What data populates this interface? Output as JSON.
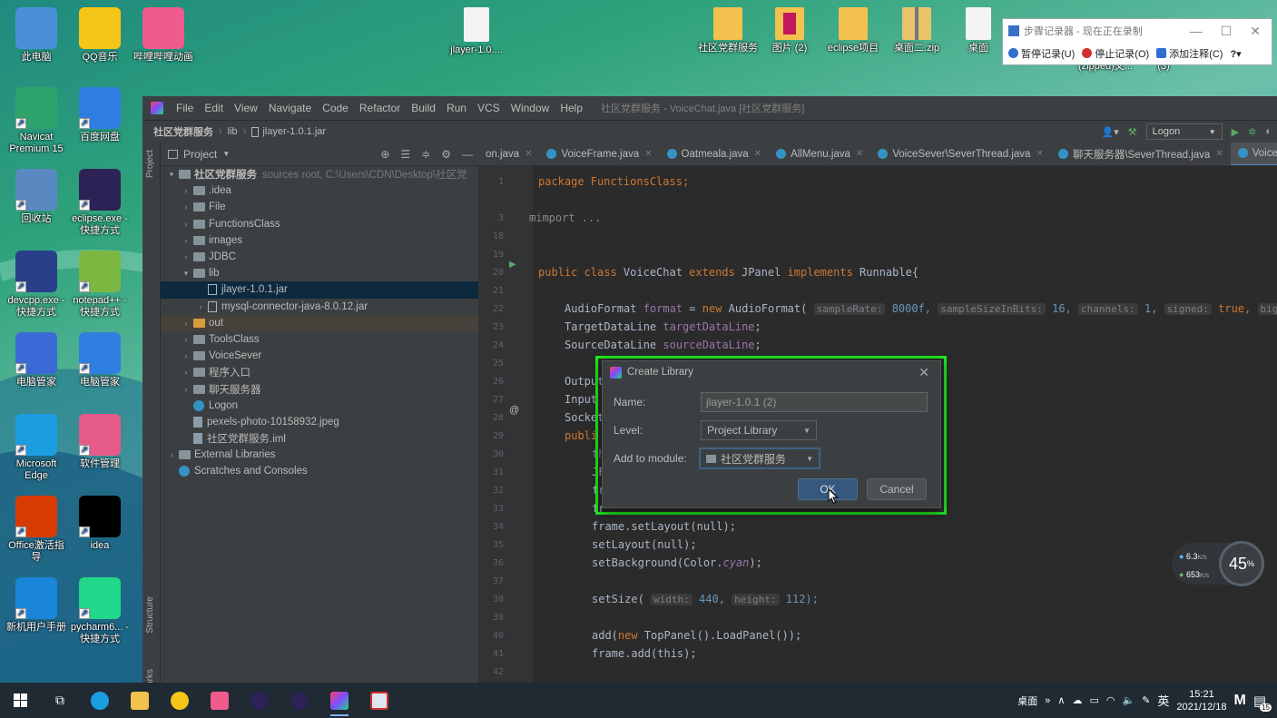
{
  "desktop": {
    "left_icons": [
      {
        "label": "此电脑",
        "icon": "computer-icon",
        "color": "#4a90d9"
      },
      {
        "label": "QQ音乐",
        "icon": "qqmusic-icon",
        "color": "#f5c518"
      },
      {
        "label": "哔哩哔哩动画",
        "icon": "bilibili-icon",
        "color": "#f05a8c"
      },
      {
        "label": "Navicat Premium 15",
        "icon": "navicat-icon",
        "color": "#2ea36b"
      },
      {
        "label": "百度网盘",
        "icon": "baidu-netdisk-icon",
        "color": "#2f7de0"
      },
      {
        "label": "回收站",
        "icon": "recycle-bin-icon",
        "color": "#5a88c0"
      },
      {
        "label": "eclipse.exe - 快捷方式",
        "icon": "eclipse-icon",
        "color": "#2c2255"
      },
      {
        "label": "devcpp.exe - 快捷方式",
        "icon": "devcpp-icon",
        "color": "#2a3f8a"
      },
      {
        "label": "notepad++ - 快捷方式",
        "icon": "notepadpp-icon",
        "color": "#7bb741"
      },
      {
        "label": "电脑管家",
        "icon": "pc-manager-icon",
        "color": "#3b6ad6"
      },
      {
        "label": "电脑管家",
        "icon": "pc-manager-shield-icon",
        "color": "#2f7fe0"
      },
      {
        "label": "Microsoft Edge",
        "icon": "edge-icon",
        "color": "#1b9de2"
      },
      {
        "label": "软件管理",
        "icon": "software-manager-icon",
        "color": "#e65a8a"
      },
      {
        "label": "Office激活指导",
        "icon": "office-icon",
        "color": "#d83b01"
      },
      {
        "label": "idea",
        "icon": "intellij-icon",
        "color": "#000000"
      },
      {
        "label": "新机用户手册",
        "icon": "manual-icon",
        "color": "#1a86d9"
      },
      {
        "label": "pycharm6... - 快捷方式",
        "icon": "pycharm-icon",
        "color": "#21d789"
      }
    ],
    "top_icons": [
      {
        "label": "jlayer-1.0....",
        "icon": "file-icon"
      },
      {
        "label": "社区党群服务",
        "icon": "folder-icon"
      },
      {
        "label": "图片 (2)",
        "icon": "folder-pictures-icon"
      },
      {
        "label": "eclipse项目",
        "icon": "folder-icon"
      },
      {
        "label": "桌面二.zip",
        "icon": "zip-icon"
      },
      {
        "label": "桌面",
        "icon": "folder-icon"
      }
    ],
    "partial_labels": [
      "(zipped)文...",
      "(3)"
    ]
  },
  "psr": {
    "title": "步骤记录器 - 现在正在录制",
    "pause": "暂停记录(U)",
    "stop": "停止记录(O)",
    "comment": "添加注释(C)"
  },
  "ide": {
    "menu": [
      "File",
      "Edit",
      "View",
      "Navigate",
      "Code",
      "Refactor",
      "Build",
      "Run",
      "VCS",
      "Window",
      "Help"
    ],
    "window_title": "社区党群服务 - VoiceChat.java [社区党群服务]",
    "breadcrumb": [
      "社区党群服务",
      "lib",
      "jlayer-1.0.1.jar"
    ],
    "run_config": "Logon",
    "project_header": "Project",
    "side_labels": {
      "project": "Project",
      "structure": "Structure",
      "bookmarks": "arks"
    },
    "tree": [
      {
        "indent": 0,
        "arrow": "▾",
        "icon": "folder",
        "label": "社区党群服务",
        "muted": "sources root,  C:\\Users\\CDN\\Desktop\\社区党"
      },
      {
        "indent": 1,
        "arrow": "›",
        "icon": "folder",
        "label": ".idea"
      },
      {
        "indent": 1,
        "arrow": "›",
        "icon": "folder",
        "label": "File"
      },
      {
        "indent": 1,
        "arrow": "›",
        "icon": "folder",
        "label": "FunctionsClass"
      },
      {
        "indent": 1,
        "arrow": "›",
        "icon": "folder",
        "label": "images"
      },
      {
        "indent": 1,
        "arrow": "›",
        "icon": "folder",
        "label": "JDBC"
      },
      {
        "indent": 1,
        "arrow": "▾",
        "icon": "folder",
        "label": "lib"
      },
      {
        "indent": 2,
        "arrow": "",
        "icon": "jar",
        "label": "jlayer-1.0.1.jar",
        "selected": true
      },
      {
        "indent": 2,
        "arrow": "›",
        "icon": "jar",
        "label": "mysql-connector-java-8.0.12.jar"
      },
      {
        "indent": 1,
        "arrow": "›",
        "icon": "folder-orange",
        "label": "out",
        "out": true
      },
      {
        "indent": 1,
        "arrow": "›",
        "icon": "folder",
        "label": "ToolsClass"
      },
      {
        "indent": 1,
        "arrow": "›",
        "icon": "folder",
        "label": "VoiceSever"
      },
      {
        "indent": 1,
        "arrow": "›",
        "icon": "folder",
        "label": "程序入口"
      },
      {
        "indent": 1,
        "arrow": "›",
        "icon": "folder",
        "label": "聊天服务器"
      },
      {
        "indent": 1,
        "arrow": "",
        "icon": "class",
        "label": "Logon"
      },
      {
        "indent": 1,
        "arrow": "",
        "icon": "image",
        "label": "pexels-photo-10158932.jpeg"
      },
      {
        "indent": 1,
        "arrow": "",
        "icon": "image",
        "label": "社区党群服务.iml"
      },
      {
        "indent": 0,
        "arrow": "›",
        "icon": "lib",
        "label": "External Libraries"
      },
      {
        "indent": 0,
        "arrow": "",
        "icon": "scratch",
        "label": "Scratches and Consoles"
      }
    ],
    "tabs": [
      {
        "label": "on.java",
        "active": false
      },
      {
        "label": "VoiceFrame.java",
        "active": false
      },
      {
        "label": "Oatmeala.java",
        "active": false
      },
      {
        "label": "AllMenu.java",
        "active": false
      },
      {
        "label": "VoiceSever\\SeverThread.java",
        "active": false
      },
      {
        "label": "聊天服务器\\SeverThread.java",
        "active": false
      },
      {
        "label": "Voice",
        "active": true
      }
    ],
    "line_numbers": [
      "1",
      "3",
      "18",
      "19",
      "20",
      "21",
      "22",
      "23",
      "24",
      "25",
      "26",
      "27",
      "28",
      "29",
      "30",
      "31",
      "32",
      "33",
      "34",
      "35",
      "36",
      "37",
      "38",
      "39",
      "40",
      "41",
      "42"
    ],
    "code": {
      "l1": "package FunctionsClass;",
      "l3": "import ...",
      "l20a": "public class ",
      "l20b": "VoiceChat ",
      "l20c": "extends ",
      "l20d": "JPanel ",
      "l20e": "implements ",
      "l20f": "Runnable{",
      "l22a": "AudioFormat ",
      "l22b": "format",
      "l22c": " = ",
      "l22d": "new ",
      "l22e": "AudioFormat(",
      "l22h1": "sampleRate:",
      "l22v1": "8000f,",
      "l22h2": "sampleSizeInBits:",
      "l22v2": "16,",
      "l22h3": "channels:",
      "l22v3": "1,",
      "l22h4": "signed:",
      "l22v4": "true,",
      "l22h5": "bigEndian:",
      "l23a": "TargetDataLine ",
      "l23b": "targetDataLine",
      "l24a": "SourceDataLine ",
      "l24b": "sourceDataLine",
      "l26": "Output",
      "l27": "Input",
      "l28": "Socket",
      "l29": "publi",
      "l30": "th",
      "l31": "JF",
      "l32": "fr",
      "l33": "fr",
      "l34": "frame.setLayout(null);",
      "l35": "setLayout(null);",
      "l36a": "setBackground(Color.",
      "l36b": "cyan",
      "l36c": ");",
      "l38a": "setSize(",
      "l38h1": "width:",
      "l38v1": "440,",
      "l38h2": "height:",
      "l38v2": "112);",
      "l40a": "add(",
      "l40b": "new ",
      "l40c": "TopPanel().LoadPanel());",
      "l41": "frame.add(this);"
    }
  },
  "dialog": {
    "title": "Create Library",
    "name_label": "Name:",
    "name_value": "jlayer-1.0.1 (2)",
    "level_label": "Level:",
    "level_value": "Project Library",
    "module_label": "Add to module:",
    "module_value": "社区党群服务",
    "ok": "OK",
    "cancel": "Cancel"
  },
  "net_widget": {
    "up": "6.3",
    "down": "653",
    "unit": "K/s",
    "cpu": "45",
    "cpu_unit": "%"
  },
  "taskbar": {
    "tray_desktop": "桌面",
    "ime": "英",
    "time": "15:21",
    "date": "2021/12/18",
    "notif_count": "15"
  },
  "colors": {
    "highlight": "#1ee81e",
    "selection": "#0d293e"
  }
}
